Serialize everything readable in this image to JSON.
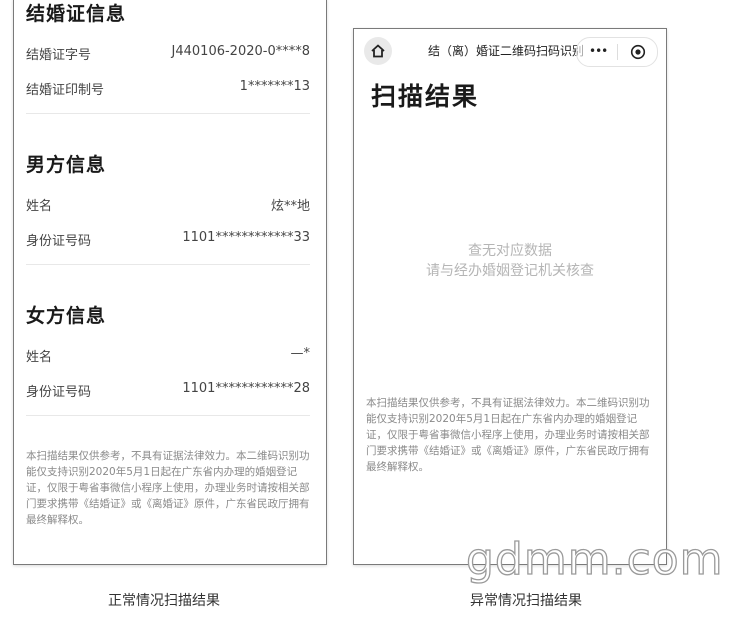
{
  "left_screen": {
    "marriage_section": {
      "title": "结婚证信息",
      "rows": [
        {
          "label": "结婚证字号",
          "value": "J440106-2020-0****8"
        },
        {
          "label": "结婚证印制号",
          "value": "1*******13"
        }
      ]
    },
    "male_section": {
      "title": "男方信息",
      "rows": [
        {
          "label": "姓名",
          "value": "炫**地"
        },
        {
          "label": "身份证号码",
          "value": "1101************33"
        }
      ]
    },
    "female_section": {
      "title": "女方信息",
      "rows": [
        {
          "label": "姓名",
          "value": "—*"
        },
        {
          "label": "身份证号码",
          "value": "1101************28"
        }
      ]
    },
    "disclaimer": "本扫描结果仅供参考，不具有证据法律效力。本二维码识别功能仅支持识别2020年5月1日起在广东省内办理的婚姻登记证，仅限于粤省事微信小程序上使用，办理业务时请按相关部门要求携带《结婚证》或《离婚证》原件，广东省民政厅拥有最终解释权。"
  },
  "right_screen": {
    "nav_title": "结（离）婚证二维码扫码识别",
    "capsule_dots": "•••",
    "heading": "扫描结果",
    "empty_line1": "查无对应数据",
    "empty_line2": "请与经办婚姻登记机关核查",
    "disclaimer": "本扫描结果仅供参考，不具有证据法律效力。本二维码识别功能仅支持识别2020年5月1日起在广东省内办理的婚姻登记证，仅限于粤省事微信小程序上使用，办理业务时请按相关部门要求携带《结婚证》或《离婚证》原件，广东省民政厅拥有最终解释权。"
  },
  "captions": {
    "left": "正常情况扫描结果",
    "right": "异常情况扫描结果"
  },
  "watermark": "gdmm.com",
  "icons": {
    "home": "home-icon",
    "more": "more-dots-icon",
    "close": "target-close-icon"
  }
}
